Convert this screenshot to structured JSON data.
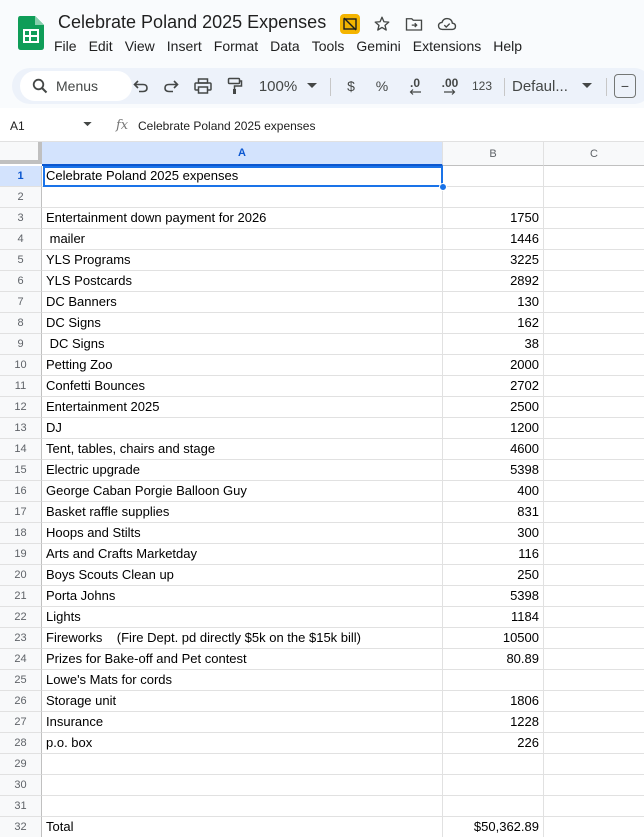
{
  "app": {
    "doc_title": "Celebrate Poland 2025 Expenses",
    "icons": [
      "sheets-logo-icon",
      "hide-on-chart-icon",
      "star-icon",
      "move-folder-icon",
      "cloud-status-icon"
    ],
    "menus": [
      "File",
      "Edit",
      "View",
      "Insert",
      "Format",
      "Data",
      "Tools",
      "Gemini",
      "Extensions",
      "Help"
    ]
  },
  "toolbar": {
    "search_label": "Menus",
    "zoom": "100%",
    "currency": "$",
    "percent": "%",
    "decrease_decimal": ".0",
    "increase_decimal": ".00",
    "number_format": "123",
    "font": "Defaul...",
    "minus": "−"
  },
  "formula_bar": {
    "cell_ref": "A1",
    "fx": "fx",
    "content": "Celebrate Poland 2025 expenses"
  },
  "sheet": {
    "columns": [
      "A",
      "B",
      "C"
    ],
    "rows": [
      {
        "num": "1",
        "a": "Celebrate Poland 2025 expenses",
        "b": ""
      },
      {
        "num": "2",
        "a": "",
        "b": ""
      },
      {
        "num": "3",
        "a": "Entertainment down payment for 2026",
        "b": "1750"
      },
      {
        "num": "4",
        "a": " mailer",
        "b": "1446"
      },
      {
        "num": "5",
        "a": "YLS Programs",
        "b": "3225"
      },
      {
        "num": "6",
        "a": "YLS Postcards",
        "b": "2892"
      },
      {
        "num": "7",
        "a": "DC Banners",
        "b": "130"
      },
      {
        "num": "8",
        "a": "DC Signs",
        "b": "162"
      },
      {
        "num": "9",
        "a": " DC Signs",
        "b": "38"
      },
      {
        "num": "10",
        "a": "Petting Zoo",
        "b": "2000"
      },
      {
        "num": "11",
        "a": "Confetti Bounces",
        "b": "2702"
      },
      {
        "num": "12",
        "a": "Entertainment 2025",
        "b": "2500"
      },
      {
        "num": "13",
        "a": "DJ",
        "b": "1200"
      },
      {
        "num": "14",
        "a": "Tent, tables, chairs and stage",
        "b": "4600"
      },
      {
        "num": "15",
        "a": "Electric upgrade",
        "b": "5398"
      },
      {
        "num": "16",
        "a": "George Caban Porgie Balloon Guy",
        "b": "400"
      },
      {
        "num": "17",
        "a": "Basket raffle supplies",
        "b": "831"
      },
      {
        "num": "18",
        "a": "Hoops and Stilts",
        "b": "300"
      },
      {
        "num": "19",
        "a": "Arts and Crafts Marketday",
        "b": "116"
      },
      {
        "num": "20",
        "a": "Boys Scouts Clean up",
        "b": "250"
      },
      {
        "num": "21",
        "a": "Porta Johns",
        "b": "5398"
      },
      {
        "num": "22",
        "a": "Lights",
        "b": "1184"
      },
      {
        "num": "23",
        "a": "Fireworks    (Fire Dept. pd directly $5k on the $15k bill)",
        "b": "10500"
      },
      {
        "num": "24",
        "a": "Prizes for Bake-off and Pet contest",
        "b": "80.89"
      },
      {
        "num": "25",
        "a": "Lowe's Mats for cords",
        "b": ""
      },
      {
        "num": "26",
        "a": "Storage unit",
        "b": "1806"
      },
      {
        "num": "27",
        "a": "Insurance",
        "b": "1228"
      },
      {
        "num": "28",
        "a": "p.o. box",
        "b": "226"
      },
      {
        "num": "29",
        "a": "",
        "b": ""
      },
      {
        "num": "30",
        "a": "",
        "b": ""
      },
      {
        "num": "31",
        "a": "",
        "b": ""
      },
      {
        "num": "32",
        "a": "Total",
        "b": "$50,362.89"
      }
    ]
  }
}
